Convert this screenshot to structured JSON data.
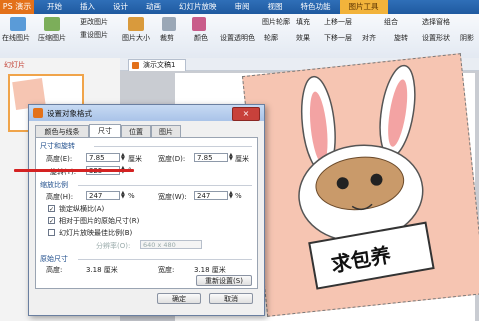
{
  "app": {
    "name": "PS 演示"
  },
  "menu": [
    "开始",
    "插入",
    "设计",
    "动画",
    "幻灯片放映",
    "审阅",
    "视图",
    "特色功能",
    "图片工具"
  ],
  "ribbon": {
    "labels": [
      "在线图片",
      "压缩图片",
      "更改图片",
      "重设图片",
      "图片大小",
      "裁剪",
      "颜色",
      "设置透明色",
      "图片轮廓",
      "轮廓",
      "效果",
      "填充",
      "上移一层",
      "下移一层",
      "组合",
      "对齐",
      "旋转",
      "选择窗格",
      "设置形状",
      "阴影"
    ]
  },
  "left_panel": {
    "tab": "幻灯片"
  },
  "doc_tab": {
    "label": "演示文稿1"
  },
  "dialog": {
    "title": "设置对象格式",
    "close": "×",
    "tabs": [
      "颜色与线条",
      "尺寸",
      "位置",
      "图片"
    ],
    "size_section": "尺寸和旋转",
    "height_label": "高度(E):",
    "height_value": "7.85",
    "height_unit": "厘米",
    "width_label": "宽度(D):",
    "width_value": "7.85",
    "width_unit": "厘米",
    "rotation_label": "旋转(T):",
    "rotation_value": "325",
    "rotation_unit": "°",
    "scale_section": "缩放比例",
    "scale_h_label": "高度(H):",
    "scale_h_value": "247",
    "scale_h_unit": "%",
    "scale_w_label": "宽度(W):",
    "scale_w_value": "247",
    "scale_w_unit": "%",
    "lock_ratio": "锁定纵横比(A)",
    "relative_size": "相对于图片的原始尺寸(R)",
    "best_scale": "幻灯片放映最佳比例(B)",
    "resolution_label": "分辨率(O):",
    "resolution_value": "640 x 480",
    "original_section": "原始尺寸",
    "orig_h_label": "高度:",
    "orig_h_value": "3.18 厘米",
    "orig_w_label": "宽度:",
    "orig_w_value": "3.18 厘米",
    "reset_button": "重新设置(S)",
    "ok_button": "确定",
    "cancel_button": "取消"
  },
  "picture": {
    "caption": "求包养"
  }
}
